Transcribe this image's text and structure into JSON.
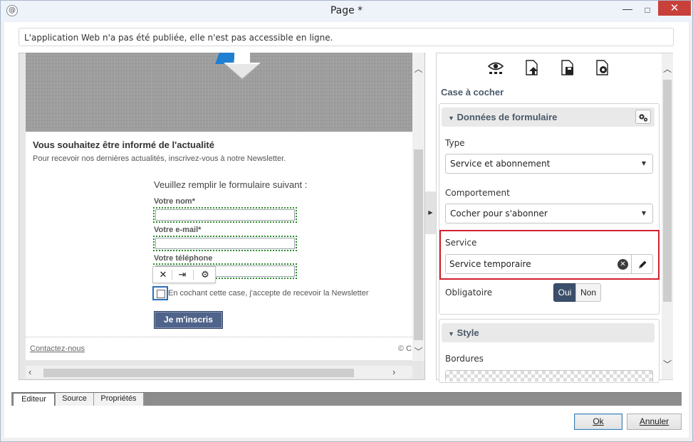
{
  "window": {
    "title": "Page *",
    "app_icon": "@",
    "minimize": "—",
    "maximize": "□",
    "close": "✕"
  },
  "notice": "L'application Web n'a pas été publiée, elle n'est pas accessible en ligne.",
  "preview": {
    "newsletter_title": "Vous souhaitez être informé de l'actualité",
    "newsletter_subtitle": "Pour recevoir nos dernières actualités, inscrivez-vous à notre Newsletter.",
    "form_title": "Veuillez remplir le formulaire suivant :",
    "fields": [
      {
        "label": "Votre nom*",
        "value": ""
      },
      {
        "label": "Votre e-mail*",
        "value": ""
      },
      {
        "label": "Votre téléphone",
        "value": ""
      }
    ],
    "checkbox_label": "En cochant cette case, j'accepte de recevoir la Newsletter",
    "subscribe_button": "Je m'inscris",
    "contact_link": "Contactez-nous",
    "copyright": "© C",
    "mini_toolbar": {
      "delete": "✕",
      "move": "⇥",
      "settings": "⚙"
    }
  },
  "properties": {
    "title": "Case à cocher",
    "toolbar_icons": [
      "eye-icon",
      "upload-page-icon",
      "save-page-icon",
      "page-settings-icon"
    ],
    "form_section": {
      "heading": "Données de formulaire",
      "type_label": "Type",
      "type_value": "Service et abonnement",
      "behavior_label": "Comportement",
      "behavior_value": "Cocher pour s'abonner",
      "service_label": "Service",
      "service_value": "Service temporaire",
      "mandatory_label": "Obligatoire",
      "mandatory_yes": "Oui",
      "mandatory_no": "Non",
      "mandatory_selected": "Oui"
    },
    "style_section": {
      "heading": "Style",
      "borders_label": "Bordures"
    }
  },
  "tabs": [
    "Editeur",
    "Source",
    "Propriétés"
  ],
  "active_tab": "Editeur",
  "buttons": {
    "ok": "Ok",
    "cancel": "Annuler"
  },
  "colors": {
    "accent": "#3b4f6b",
    "highlight": "#d2202f",
    "subscribe": "#50638a",
    "close": "#c7403a"
  }
}
